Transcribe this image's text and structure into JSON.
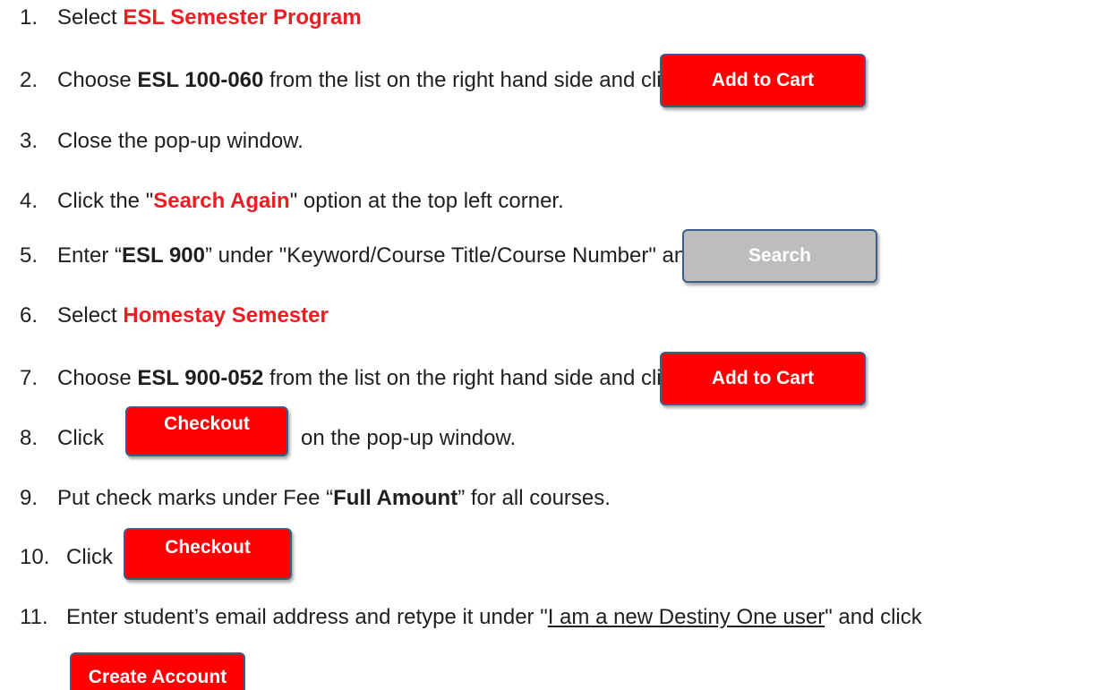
{
  "steps": [
    {
      "num": "1.",
      "pre": "Select ",
      "strong": "ESL Semester Program"
    },
    {
      "num": "2.",
      "pre": "Choose ",
      "strong": "ESL 100-060",
      "post": " from the list on the right hand side and click"
    },
    {
      "num": "3.",
      "text": "Close the pop-up window."
    },
    {
      "num": "4.",
      "pre": "Click the \"",
      "strong": "Search Again",
      "post": "\" option at the top left corner."
    },
    {
      "num": "5.",
      "pre": "Enter “",
      "strong": "ESL 900",
      "post": "” under \"Keyword/Course Title/Course Number\" and click"
    },
    {
      "num": "6.",
      "pre": "Select ",
      "strong": "Homestay Semester"
    },
    {
      "num": "7.",
      "pre": "Choose ",
      "strong": "ESL 900-052",
      "post": " from the list on the right hand side and click"
    },
    {
      "num": "8.",
      "pre": "Click",
      "post": "on the pop-up window."
    },
    {
      "num": "9.",
      "pre": "Put check marks under Fee “",
      "strong": "Full Amount",
      "post": "” for all courses."
    },
    {
      "num": "10.",
      "pre": "Click"
    },
    {
      "num": "11.",
      "pre": "Enter student’s email address and retype it under \"",
      "link": "I am a new Destiny One user",
      "post": "\" and click"
    }
  ],
  "buttons": {
    "add_to_cart": "Add to Cart",
    "search": "Search",
    "checkout": "Checkout",
    "create_account": "Create Account"
  },
  "colors": {
    "accent": "#ee1d23",
    "button_red": "#ff0000",
    "button_grey": "#bdbdbd",
    "button_border": "#3b5f8a"
  }
}
